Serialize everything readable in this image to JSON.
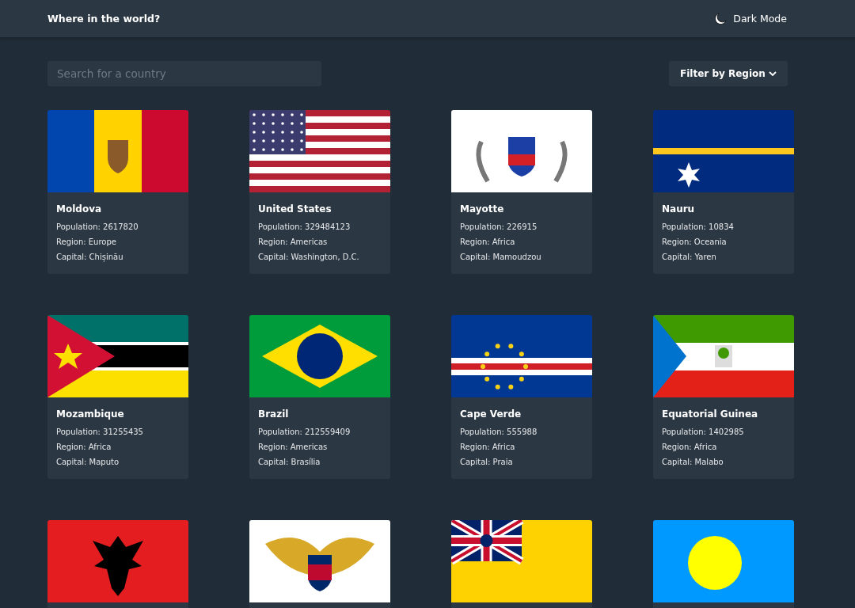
{
  "header": {
    "title": "Where in the world?",
    "theme_toggle": "Dark Mode"
  },
  "search": {
    "placeholder": "Search for a country"
  },
  "filter": {
    "label": "Filter by Region"
  },
  "countries": [
    {
      "kind": "moldova",
      "name": "Moldova",
      "population": "Population: 2617820",
      "region": "Region: Europe",
      "capital": "Capital: Chișinău"
    },
    {
      "kind": "usa",
      "name": "United States",
      "population": "Population: 329484123",
      "region": "Region: Americas",
      "capital": "Capital: Washington, D.C."
    },
    {
      "kind": "mayotte",
      "name": "Mayotte",
      "population": "Population: 226915",
      "region": "Region: Africa",
      "capital": "Capital: Mamoudzou"
    },
    {
      "kind": "nauru",
      "name": "Nauru",
      "population": "Population: 10834",
      "region": "Region: Oceania",
      "capital": "Capital: Yaren"
    },
    {
      "kind": "mozambique",
      "name": "Mozambique",
      "population": "Population: 31255435",
      "region": "Region: Africa",
      "capital": "Capital: Maputo"
    },
    {
      "kind": "brazil",
      "name": "Brazil",
      "population": "Population: 212559409",
      "region": "Region: Americas",
      "capital": "Capital: Brasília"
    },
    {
      "kind": "capeverde",
      "name": "Cape Verde",
      "population": "Population: 555988",
      "region": "Region: Africa",
      "capital": "Capital: Praia"
    },
    {
      "kind": "eqguinea",
      "name": "Equatorial Guinea",
      "population": "Population: 1402985",
      "region": "Region: Africa",
      "capital": "Capital: Malabo"
    },
    {
      "kind": "albania"
    },
    {
      "kind": "virginislands"
    },
    {
      "kind": "niue"
    },
    {
      "kind": "palau"
    }
  ]
}
